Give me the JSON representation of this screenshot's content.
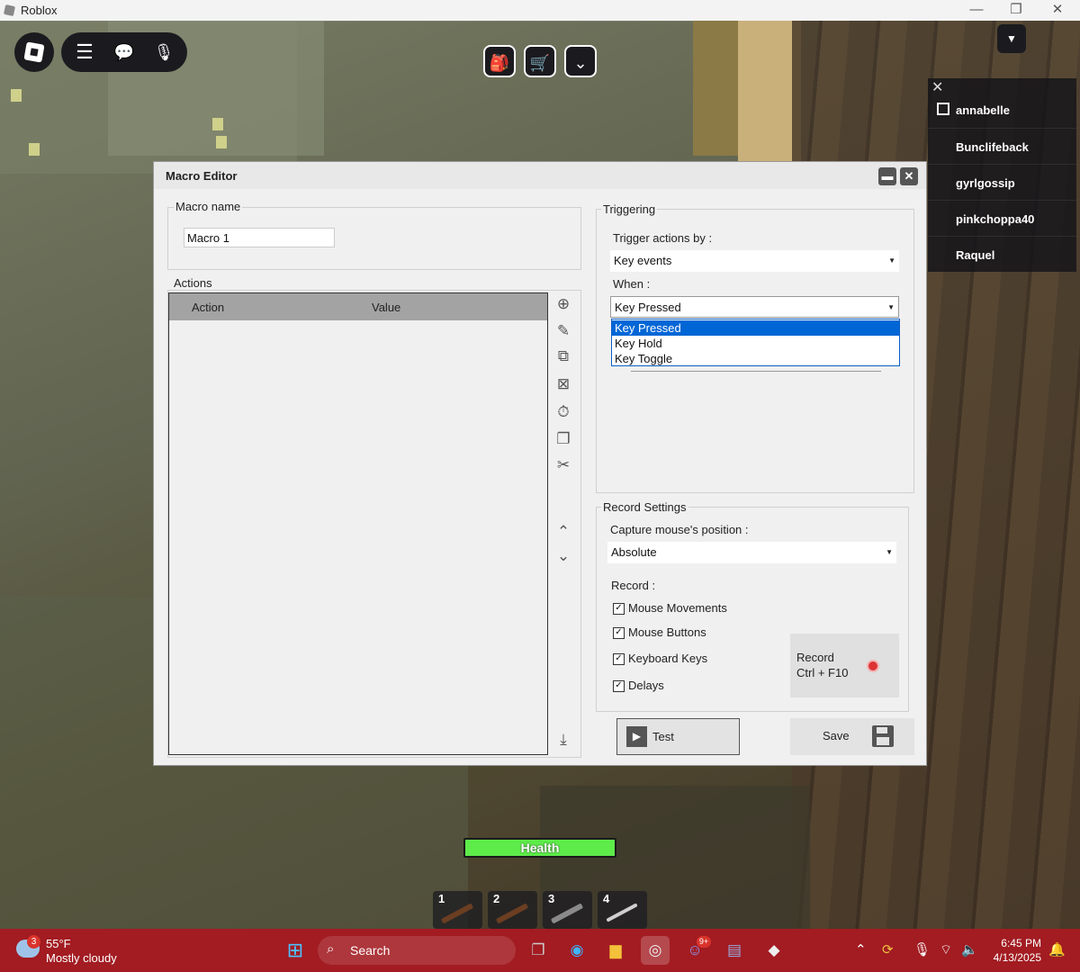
{
  "window": {
    "title": "Roblox",
    "min_label": "—",
    "max_label": "❐",
    "close_label": "✕"
  },
  "hud": {
    "menu_icon": "☰",
    "chat_icon": "💬",
    "mic_icon": "🎙",
    "backpack_icon": "🎒",
    "cart_icon": "🛒",
    "chevron_icon": "⌄",
    "dropdown_icon": "▼"
  },
  "players": {
    "close_label": "✕",
    "names": [
      "annabelle",
      "Bunclifeback",
      "gyrlgossip",
      "pinkchoppa40",
      "Raquel"
    ]
  },
  "editor": {
    "title": "Macro Editor",
    "min_label": "▬",
    "close_label": "✕",
    "macro_name_label": "Macro name",
    "macro_name_value": "Macro 1",
    "actions_label": "Actions",
    "col_action": "Action",
    "col_value": "Value",
    "triggering_label": "Triggering",
    "trigger_by_label": "Trigger actions by :",
    "trigger_by_value": "Key events",
    "when_label": "When :",
    "when_value": "Key Pressed",
    "when_options": [
      "Key Pressed",
      "Key Hold",
      "Key Toggle"
    ],
    "record_settings_label": "Record Settings",
    "capture_label": "Capture mouse's position :",
    "capture_value": "Absolute",
    "record_label": "Record :",
    "record_items": [
      "Mouse Movements",
      "Mouse Buttons",
      "Keyboard Keys",
      "Delays"
    ],
    "record_items_checked": [
      true,
      true,
      true,
      true
    ],
    "record_button_line1": "Record",
    "record_button_line2": "Ctrl + F10",
    "test_label": "Test",
    "save_label": "Save",
    "side_icons": [
      "add-icon",
      "edit-icon",
      "insert-icon",
      "delete-icon",
      "timer-icon",
      "copy-icon",
      "clean-icon",
      "move-up-icon",
      "move-down-icon",
      "import-icon"
    ]
  },
  "game_hud": {
    "health_label": "Health",
    "slots": [
      "1",
      "2",
      "3",
      "4"
    ]
  },
  "taskbar": {
    "weather_badge": "3",
    "weather_temp": "55°F",
    "weather_desc": "Mostly cloudy",
    "search_label": "Search",
    "discord_badge": "9+",
    "time": "6:45 PM",
    "date": "4/13/2025"
  }
}
